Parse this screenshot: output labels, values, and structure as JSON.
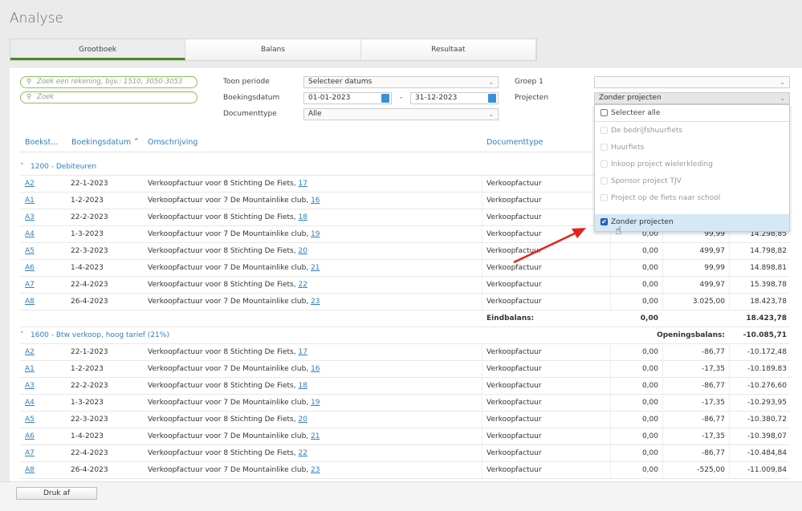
{
  "title": "Analyse",
  "tabs": [
    {
      "label": "Grootboek",
      "active": true
    },
    {
      "label": "Balans"
    },
    {
      "label": "Resultaat"
    }
  ],
  "filters": {
    "account_search_placeholder": "Zoek een rekening, bijv.: 1510, 3050-3053",
    "search_placeholder": "Zoek",
    "toon_periode_label": "Toon periode",
    "toon_periode_value": "Selecteer datums",
    "boekingsdatum_label": "Boekingsdatum",
    "date_from": "01-01-2023",
    "date_sep": "-",
    "date_to": "31-12-2023",
    "documenttype_label": "Documenttype",
    "documenttype_value": "Alle",
    "groep_label": "Groep 1",
    "groep_value": "",
    "projecten_label": "Projecten",
    "projecten_value": "Zonder projecten"
  },
  "dropdown": {
    "select_all": "Selecteer alle",
    "items": [
      {
        "label": "De bedrijfshuurfiets",
        "checked": false,
        "disabled": true
      },
      {
        "label": "Huurfiets",
        "checked": false,
        "disabled": true
      },
      {
        "label": "Inkoop project wielerkleding",
        "checked": false,
        "disabled": true
      },
      {
        "label": "Sponsor project TJV",
        "checked": false,
        "disabled": true
      },
      {
        "label": "Project op de fiets naar school",
        "checked": false,
        "disabled": true
      },
      {
        "label": "Zonder projecten",
        "checked": true
      }
    ]
  },
  "columns": {
    "boekstuk": "Boekst...",
    "boekingsdatum": "Boekingsdatum",
    "omschrijving": "Omschrijving",
    "documenttype": "Documenttype"
  },
  "groups": [
    {
      "title": "1200 - Debiteuren",
      "rows": [
        [
          "A2",
          "22-1-2023",
          "Verkoopfactuur voor 8 Stichting De Fiets, ",
          "17",
          "Verkoopfactuur",
          "",
          "",
          ""
        ],
        [
          "A1",
          "1-2-2023",
          "Verkoopfactuur voor 7 De Mountainlike club, ",
          "16",
          "Verkoopfactuur",
          "",
          "",
          ""
        ],
        [
          "A3",
          "22-2-2023",
          "Verkoopfactuur voor 8 Stichting De Fiets, ",
          "18",
          "Verkoopfactuur",
          "",
          "",
          ""
        ],
        [
          "A4",
          "1-3-2023",
          "Verkoopfactuur voor 7 De Mountainlike club, ",
          "19",
          "Verkoopfactuur",
          "0,00",
          "99,99",
          "14.298,85"
        ],
        [
          "A5",
          "22-3-2023",
          "Verkoopfactuur voor 8 Stichting De Fiets, ",
          "20",
          "Verkoopfactuur",
          "0,00",
          "499,97",
          "14.798,82"
        ],
        [
          "A6",
          "1-4-2023",
          "Verkoopfactuur voor 7 De Mountainlike club, ",
          "21",
          "Verkoopfactuur",
          "0,00",
          "99,99",
          "14.898,81"
        ],
        [
          "A7",
          "22-4-2023",
          "Verkoopfactuur voor 8 Stichting De Fiets, ",
          "22",
          "Verkoopfactuur",
          "0,00",
          "499,97",
          "15.398,78"
        ],
        [
          "A8",
          "26-4-2023",
          "Verkoopfactuur voor 7 De Mountainlike club, ",
          "23",
          "Verkoopfactuur",
          "0,00",
          "3.025,00",
          "18.423,78"
        ]
      ],
      "end_label": "Eindbalans:",
      "end_debit": "0,00",
      "end_saldo": "18.423,78"
    },
    {
      "title": "1600 - Btw verkoop, hoog tarief (21%)",
      "opening_label": "Openingsbalans:",
      "opening_saldo": "-10.085,71",
      "rows": [
        [
          "A2",
          "22-1-2023",
          "Verkoopfactuur voor 8 Stichting De Fiets, ",
          "17",
          "Verkoopfactuur",
          "0,00",
          "-86,77",
          "-10.172,48"
        ],
        [
          "A1",
          "1-2-2023",
          "Verkoopfactuur voor 7 De Mountainlike club, ",
          "16",
          "Verkoopfactuur",
          "0,00",
          "-17,35",
          "-10.189,83"
        ],
        [
          "A3",
          "22-2-2023",
          "Verkoopfactuur voor 8 Stichting De Fiets, ",
          "18",
          "Verkoopfactuur",
          "0,00",
          "-86,77",
          "-10.276,60"
        ],
        [
          "A4",
          "1-3-2023",
          "Verkoopfactuur voor 7 De Mountainlike club, ",
          "19",
          "Verkoopfactuur",
          "0,00",
          "-17,35",
          "-10.293,95"
        ],
        [
          "A5",
          "22-3-2023",
          "Verkoopfactuur voor 8 Stichting De Fiets, ",
          "20",
          "Verkoopfactuur",
          "0,00",
          "-86,77",
          "-10.380,72"
        ],
        [
          "A6",
          "1-4-2023",
          "Verkoopfactuur voor 7 De Mountainlike club, ",
          "21",
          "Verkoopfactuur",
          "0,00",
          "-17,35",
          "-10.398,07"
        ],
        [
          "A7",
          "22-4-2023",
          "Verkoopfactuur voor 8 Stichting De Fiets, ",
          "22",
          "Verkoopfactuur",
          "0,00",
          "-86,77",
          "-10.484,84"
        ],
        [
          "A8",
          "26-4-2023",
          "Verkoopfactuur voor 7 De Mountainlike club, ",
          "23",
          "Verkoopfactuur",
          "0,00",
          "-525,00",
          "-11.009,84"
        ]
      ]
    }
  ],
  "footer": {
    "print_label": "Druk af"
  },
  "colors": {
    "accent": "#2f7fc1",
    "tab_active": "#4a8b1e",
    "search_border": "#8cc152",
    "arrow": "#e8201a"
  }
}
